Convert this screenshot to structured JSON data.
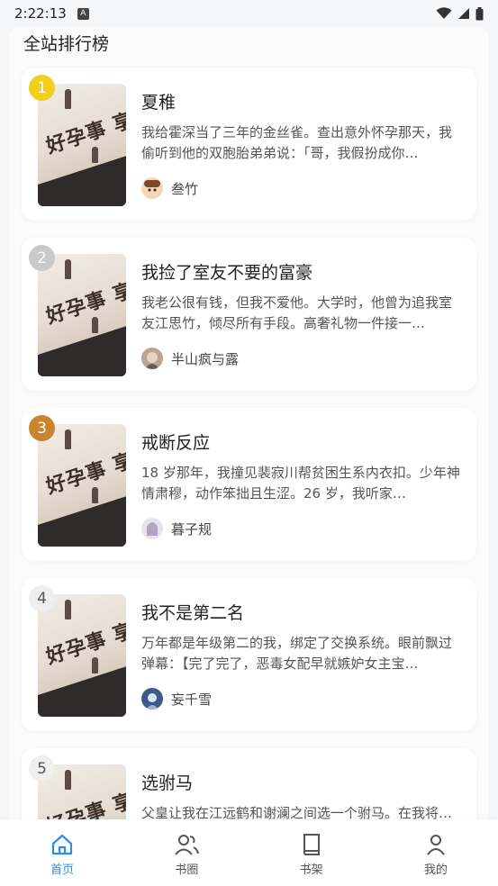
{
  "status_bar": {
    "time": "2:22:13",
    "badge": "A"
  },
  "section_title": "全站排行榜",
  "books": [
    {
      "rank": "1",
      "rank_color": "#f2cf1a",
      "title": "夏稚",
      "desc": "我给霍深当了三年的金丝雀。查出意外怀孕那天，我偷听到他的双胞胎弟弟说：「哥，我假扮成你…",
      "author": "叁竹"
    },
    {
      "rank": "2",
      "rank_color": "#c9c9c9",
      "title": "我捡了室友不要的富豪",
      "desc": "我老公很有钱，但我不爱他。大学时，他曾为追我室友江思竹，倾尽所有手段。高奢礼物一件接一…",
      "author": "半山疯与露"
    },
    {
      "rank": "3",
      "rank_color": "#c8842f",
      "title": "戒断反应",
      "desc": "18 岁那年，我撞见裴寂川帮贫困生系内衣扣。少年神情肃穆，动作笨拙且生涩。26 岁，我听家…",
      "author": "暮子规"
    },
    {
      "rank": "4",
      "rank_color": "#efefef",
      "title": "我不是第二名",
      "desc": "万年都是年级第二的我，绑定了交换系统。眼前飘过弹幕：【完了完了，恶毒女配早就嫉妒女主宝…",
      "author": "妄千雪"
    },
    {
      "rank": "5",
      "rank_color": "#efefef",
      "title": "选驸马",
      "desc": "父皇让我在江远鹤和谢澜之间选一个驸马。在我将…",
      "author": ""
    }
  ],
  "cover_text": "好孕事 享快乐",
  "tabs": [
    {
      "label": "首页",
      "icon": "home-icon",
      "active": true
    },
    {
      "label": "书圈",
      "icon": "people-icon",
      "active": false
    },
    {
      "label": "书架",
      "icon": "book-icon",
      "active": false
    },
    {
      "label": "我的",
      "icon": "person-icon",
      "active": false
    }
  ],
  "colors": {
    "accent": "#2b8fe6",
    "page_bg": "#f5f6f8"
  }
}
